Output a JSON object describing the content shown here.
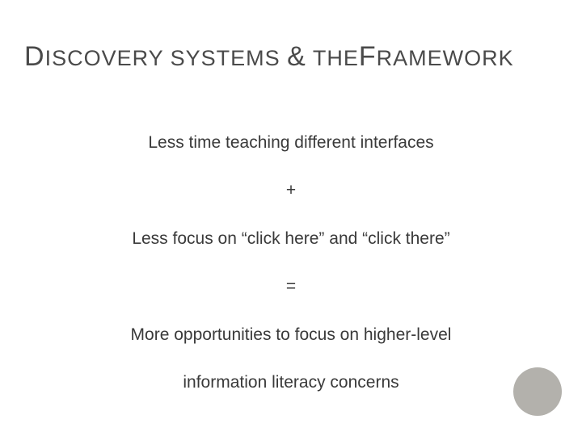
{
  "title": {
    "part1_cap": "D",
    "part1_rest": "ISCOVERY SYSTEMS",
    "amp": "&",
    "part2_small": "THE",
    "part2_cap": "F",
    "part2_rest": "RAMEWORK"
  },
  "body": {
    "line1": "Less time teaching different interfaces",
    "op1": "+",
    "line2": "Less focus on “click here” and “click there”",
    "op2": "=",
    "line3a": "More opportunities to focus on higher-level",
    "line3b": "information literacy concerns"
  }
}
